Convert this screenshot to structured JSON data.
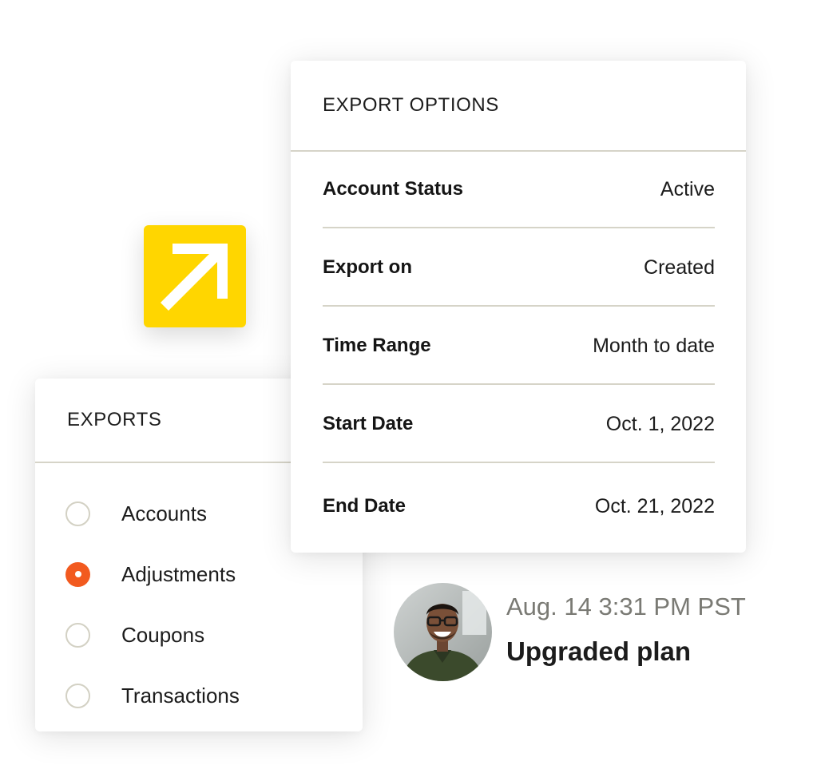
{
  "export_options": {
    "title": "EXPORT OPTIONS",
    "rows": [
      {
        "label": "Account Status",
        "value": "Active"
      },
      {
        "label": "Export on",
        "value": "Created"
      },
      {
        "label": "Time Range",
        "value": "Month to date"
      },
      {
        "label": "Start Date",
        "value": "Oct. 1, 2022"
      },
      {
        "label": "End Date",
        "value": "Oct. 21, 2022"
      }
    ]
  },
  "exports": {
    "title": "EXPORTS",
    "items": [
      {
        "label": "Accounts",
        "selected": false
      },
      {
        "label": "Adjustments",
        "selected": true
      },
      {
        "label": "Coupons",
        "selected": false
      },
      {
        "label": "Transactions",
        "selected": false
      }
    ]
  },
  "activity": {
    "timestamp": "Aug. 14 3:31 PM PST",
    "event": "Upgraded plan"
  },
  "colors": {
    "accent_tile": "#ffd600",
    "radio_selected": "#f25a1f",
    "divider": "#d6d4c8"
  },
  "icons": {
    "tile": "arrow-up-right-icon",
    "avatar": "user-avatar-photo"
  }
}
